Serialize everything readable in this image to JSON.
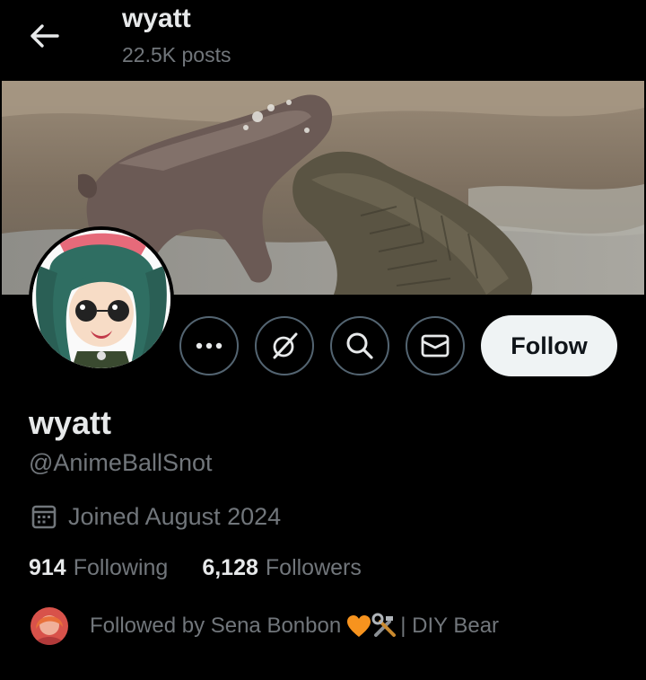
{
  "header": {
    "title": "wyatt",
    "post_count": "22.5K posts"
  },
  "actions": {
    "follow_label": "Follow"
  },
  "profile": {
    "display_name": "wyatt",
    "handle": "@AnimeBallSnot",
    "joined": "Joined August 2024"
  },
  "stats": {
    "following_count": "914",
    "following_label": "Following",
    "followers_count": "6,128",
    "followers_label": "Followers"
  },
  "followed_by": {
    "prefix": "Followed by Sena Bonbon",
    "suffix": "| DIY Bear",
    "emojis": [
      "orange-heart-icon",
      "hammer-and-wrench-icon"
    ]
  },
  "colors": {
    "background": "#000000",
    "primary_text": "#e7e9ea",
    "secondary_text": "#71767b",
    "button_border": "#536471",
    "follow_button_bg": "#eff3f4",
    "follow_button_text": "#0f1419",
    "heart": "#f7931e"
  }
}
